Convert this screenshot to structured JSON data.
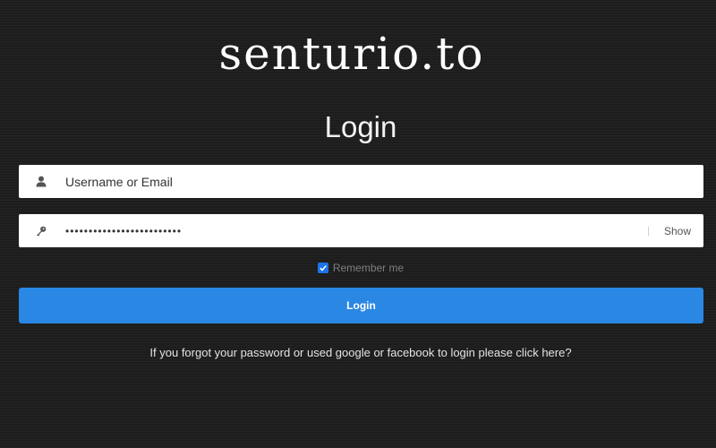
{
  "logo": {
    "text": "senturio.to"
  },
  "heading": "Login",
  "username": {
    "placeholder": "Username or Email",
    "icon": "user-icon"
  },
  "password": {
    "value": "•••••••••••••••••••••••••",
    "icon": "key-icon",
    "show_label": "Show"
  },
  "remember": {
    "label": "Remember me",
    "checked": true
  },
  "login_button": "Login",
  "forgot_link": "If you forgot your password or used google or facebook to login please click here?",
  "colors": {
    "background": "#1f1f1f",
    "button": "#2a87e4",
    "checkbox": "#1a73e8"
  }
}
